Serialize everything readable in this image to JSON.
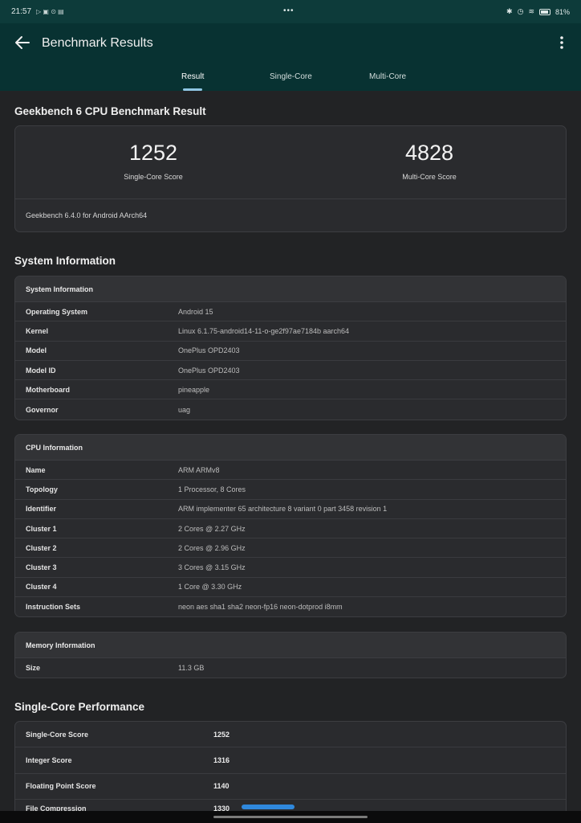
{
  "status_bar": {
    "time": "21:57",
    "center": "•••",
    "battery": "81%"
  },
  "app_bar": {
    "title": "Benchmark Results"
  },
  "tabs": [
    {
      "label": "Result",
      "active": true
    },
    {
      "label": "Single-Core",
      "active": false
    },
    {
      "label": "Multi-Core",
      "active": false
    }
  ],
  "result": {
    "title": "Geekbench 6 CPU Benchmark Result",
    "single_core": {
      "value": "1252",
      "label": "Single-Core Score"
    },
    "multi_core": {
      "value": "4828",
      "label": "Multi-Core Score"
    },
    "version": "Geekbench 6.4.0 for Android AArch64"
  },
  "system_information": {
    "section_title": "System Information",
    "system": {
      "header": "System Information",
      "rows": [
        {
          "key": "Operating System",
          "value": "Android 15"
        },
        {
          "key": "Kernel",
          "value": "Linux 6.1.75-android14-11-o-ge2f97ae7184b aarch64"
        },
        {
          "key": "Model",
          "value": "OnePlus OPD2403"
        },
        {
          "key": "Model ID",
          "value": "OnePlus OPD2403"
        },
        {
          "key": "Motherboard",
          "value": "pineapple"
        },
        {
          "key": "Governor",
          "value": "uag"
        }
      ]
    },
    "cpu": {
      "header": "CPU Information",
      "rows": [
        {
          "key": "Name",
          "value": "ARM ARMv8"
        },
        {
          "key": "Topology",
          "value": "1 Processor, 8 Cores"
        },
        {
          "key": "Identifier",
          "value": "ARM implementer 65 architecture 8 variant 0 part 3458 revision 1"
        },
        {
          "key": "Cluster 1",
          "value": "2 Cores @ 2.27 GHz"
        },
        {
          "key": "Cluster 2",
          "value": "2 Cores @ 2.96 GHz"
        },
        {
          "key": "Cluster 3",
          "value": "3 Cores @ 3.15 GHz"
        },
        {
          "key": "Cluster 4",
          "value": "1 Core @ 3.30 GHz"
        },
        {
          "key": "Instruction Sets",
          "value": "neon aes sha1 sha2 neon-fp16 neon-dotprod i8mm"
        }
      ]
    },
    "memory": {
      "header": "Memory Information",
      "rows": [
        {
          "key": "Size",
          "value": "11.3 GB"
        }
      ]
    }
  },
  "single_core_performance": {
    "section_title": "Single-Core Performance",
    "rows": [
      {
        "key": "Single-Core Score",
        "value": "1252"
      },
      {
        "key": "Integer Score",
        "value": "1316"
      },
      {
        "key": "Floating Point Score",
        "value": "1140"
      },
      {
        "key": "File Compression",
        "value": "1330"
      }
    ]
  },
  "colors": {
    "app_bar": "#083232",
    "background": "#222325",
    "accent": "#8fc6e3",
    "bar": "#2f88dc"
  }
}
